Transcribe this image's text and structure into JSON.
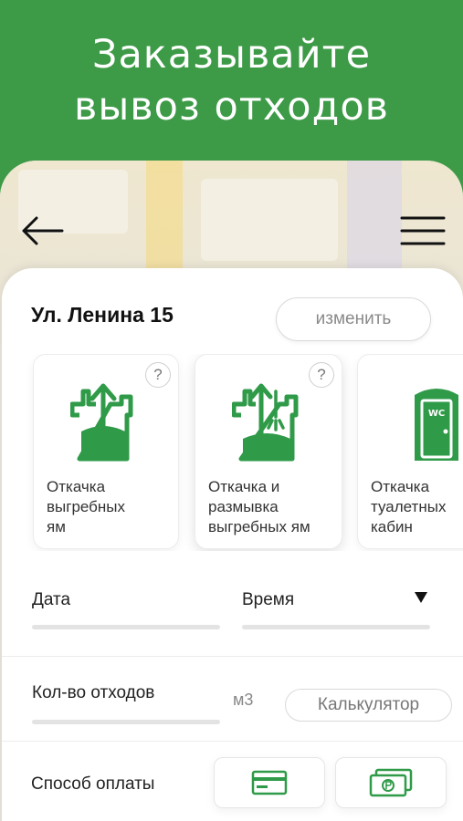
{
  "hero": {
    "line1": "Заказывайте",
    "line2": "вывоз отходов"
  },
  "colors": {
    "brand": "#3d9a47",
    "icon": "#2f9a48"
  },
  "address": {
    "text": "Ул. Ленина 15",
    "change_label": "изменить"
  },
  "services": [
    {
      "label": "Откачка\nвыгребных\nям",
      "help": "?",
      "icon": "pit-pump-icon"
    },
    {
      "label": "Откачка и\nразмывка\nвыгребных ям",
      "help": "?",
      "icon": "pit-wash-icon"
    },
    {
      "label": "Откачка\nтуалетных\nкабин",
      "icon": "toilet-cabin-icon",
      "badge": "WC"
    }
  ],
  "form": {
    "date_label": "Дата",
    "time_label": "Время",
    "amount_label": "Кол-во отходов",
    "unit": "м3",
    "calc_label": "Калькулятор",
    "payment_label": "Способ оплаты"
  },
  "payment_methods": [
    "card-icon",
    "cash-ruble-icon"
  ]
}
